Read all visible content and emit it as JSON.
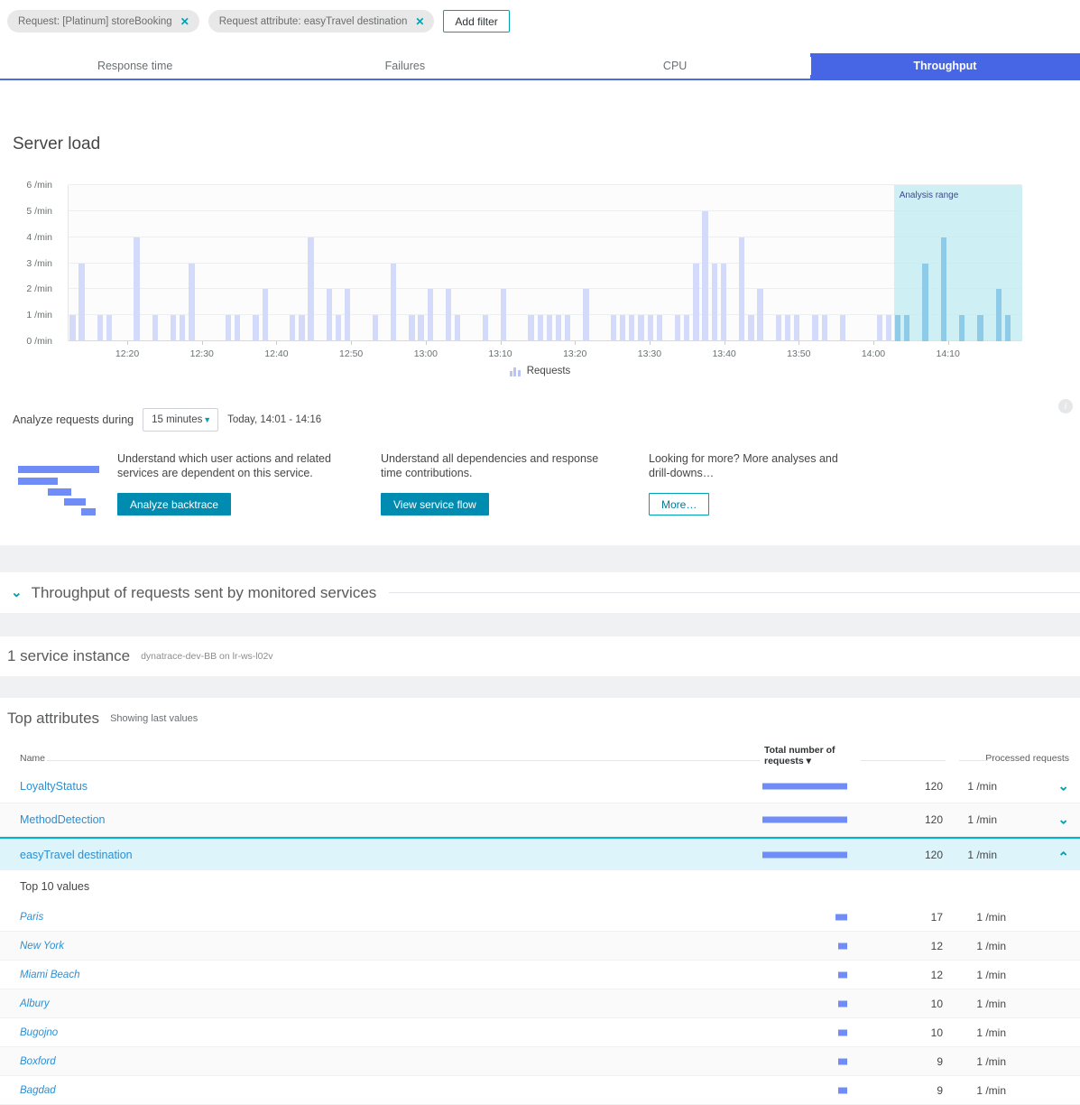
{
  "filters": {
    "chips": [
      {
        "label": "Request: [Platinum] storeBooking",
        "remove_icon": "close-icon"
      },
      {
        "label": "Request attribute: easyTravel destination",
        "remove_icon": "close-icon"
      }
    ],
    "add_filter_label": "Add filter"
  },
  "tabs": [
    {
      "label": "Response time",
      "active": false
    },
    {
      "label": "Failures",
      "active": false
    },
    {
      "label": "CPU",
      "active": false
    },
    {
      "label": "Throughput",
      "active": true
    }
  ],
  "server_load": {
    "title": "Server load",
    "legend_label": "Requests",
    "analysis_range_label": "Analysis range"
  },
  "chart_data": {
    "type": "bar",
    "title": "Server load",
    "xlabel": "",
    "ylabel": "/min",
    "ylim": [
      0,
      6
    ],
    "yticks": [
      "0 /min",
      "1 /min",
      "2 /min",
      "3 /min",
      "4 /min",
      "5 /min",
      "6 /min"
    ],
    "xticks": [
      "12:20",
      "12:30",
      "12:40",
      "12:50",
      "13:00",
      "13:10",
      "13:20",
      "13:30",
      "13:40",
      "13:50",
      "14:00",
      "14:10"
    ],
    "grid": true,
    "legend": "Requests",
    "legend_position": "bottom",
    "annotations": [
      {
        "text": "Analysis range",
        "x_start": "14:01",
        "x_end": "14:16"
      }
    ],
    "bar_color": "#d4dbfa",
    "highlight_bar_color": "#8ecbe8",
    "series": [
      {
        "name": "Requests",
        "values": [
          1,
          3,
          0,
          1,
          1,
          0,
          0,
          4,
          0,
          1,
          0,
          1,
          1,
          3,
          0,
          0,
          0,
          1,
          1,
          0,
          1,
          2,
          0,
          0,
          1,
          1,
          4,
          0,
          2,
          1,
          2,
          0,
          0,
          1,
          0,
          3,
          0,
          1,
          1,
          2,
          0,
          2,
          1,
          0,
          0,
          1,
          0,
          2,
          0,
          0,
          1,
          1,
          1,
          1,
          1,
          0,
          2,
          0,
          0,
          1,
          1,
          1,
          1,
          1,
          1,
          0,
          1,
          1,
          3,
          5,
          3,
          3,
          0,
          4,
          1,
          2,
          0,
          1,
          1,
          1,
          0,
          1,
          1,
          0,
          1,
          0,
          0,
          0,
          1,
          1,
          1,
          1,
          0,
          3,
          0,
          4,
          0,
          1,
          0,
          1,
          0,
          2,
          1,
          0
        ]
      }
    ]
  },
  "analyze": {
    "label": "Analyze requests during",
    "duration_value": "15 minutes",
    "duration_caret": "chevron-down-icon",
    "time_range": "Today, 14:01 - 14:16",
    "info_icon": "info-icon"
  },
  "cards": [
    {
      "text": "Understand which user actions and related services are dependent on this service.",
      "button": "Analyze backtrace",
      "style": "primary"
    },
    {
      "text": "Understand all dependencies and response time contributions.",
      "button": "View service flow",
      "style": "primary"
    },
    {
      "text": "Looking for more? More analyses and drill-downs…",
      "button": "More…",
      "style": "outline"
    }
  ],
  "throughput_section": {
    "chevron": "chevron-down-icon",
    "heading": "Throughput of requests sent by monitored services"
  },
  "service_instance": {
    "count_label": "1 service instance",
    "detail": "dynatrace-dev-BB on lr-ws-l02v"
  },
  "top_attributes": {
    "heading": "Top attributes",
    "subheading": "Showing last values",
    "columns": {
      "name": "Name",
      "total": "Total number of requests ▾",
      "processed": "Processed requests"
    },
    "rows": [
      {
        "name": "LoyaltyStatus",
        "bar": 120,
        "total": "120",
        "rate": "1 /min",
        "chev": "chevron-down-icon",
        "selected": false
      },
      {
        "name": "MethodDetection",
        "bar": 120,
        "total": "120",
        "rate": "1 /min",
        "chev": "chevron-down-icon",
        "selected": false
      },
      {
        "name": "easyTravel destination",
        "bar": 120,
        "total": "120",
        "rate": "1 /min",
        "chev": "chevron-up-icon",
        "selected": true
      }
    ],
    "top10_label": "Top 10 values",
    "values": [
      {
        "name": "Paris",
        "bar": 17,
        "total": "17",
        "rate": "1 /min"
      },
      {
        "name": "New York",
        "bar": 12,
        "total": "12",
        "rate": "1 /min"
      },
      {
        "name": "Miami Beach",
        "bar": 12,
        "total": "12",
        "rate": "1 /min"
      },
      {
        "name": "Albury",
        "bar": 10,
        "total": "10",
        "rate": "1 /min"
      },
      {
        "name": "Bugojno",
        "bar": 10,
        "total": "10",
        "rate": "1 /min"
      },
      {
        "name": "Boxford",
        "bar": 9,
        "total": "9",
        "rate": "1 /min"
      },
      {
        "name": "Bagdad",
        "bar": 9,
        "total": "9",
        "rate": "1 /min"
      }
    ]
  },
  "colors": {
    "accent_teal": "#00a1b2",
    "tab_active_blue": "#4666e5",
    "bar_blue": "#6f8cf7",
    "chart_bar": "#d4dbfa",
    "analysis_range": "#c5ecf2",
    "link_blue": "#2a8fd4"
  }
}
